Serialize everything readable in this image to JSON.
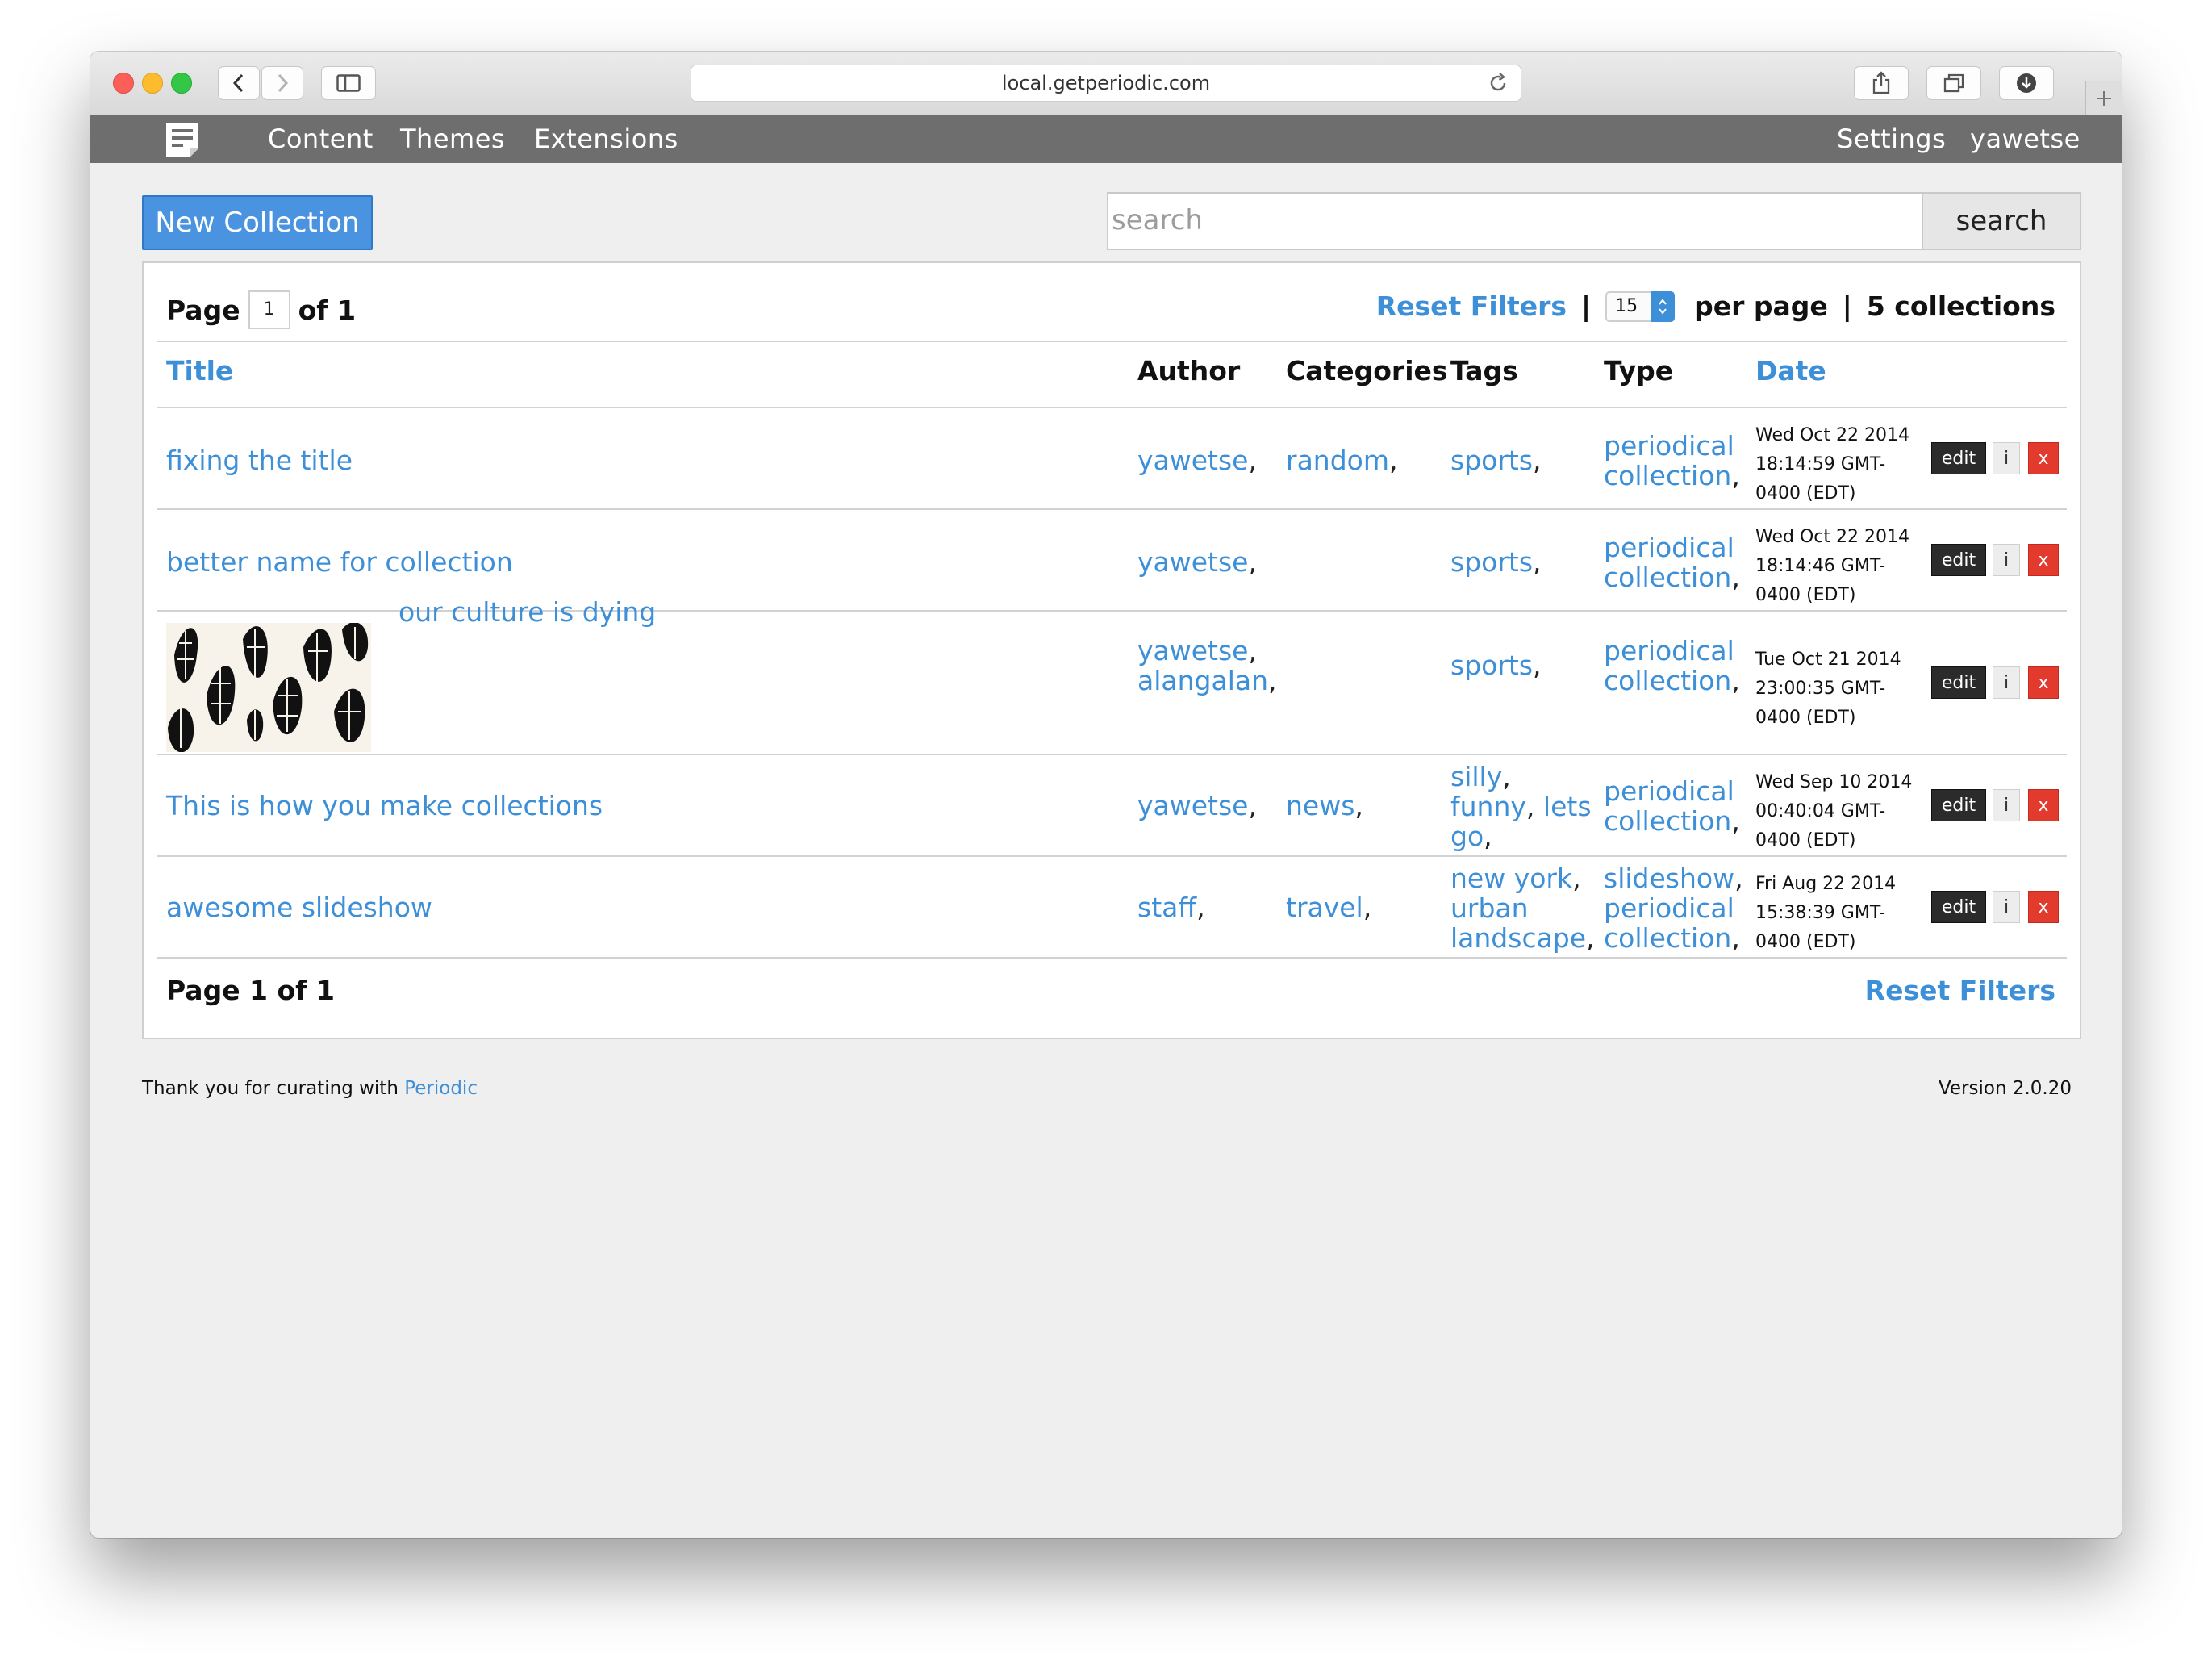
{
  "browser": {
    "url": "local.getperiodic.com"
  },
  "nav": {
    "left": [
      "Content",
      "Themes",
      "Extensions"
    ],
    "right": [
      "Settings",
      "yawetse"
    ]
  },
  "toolbar": {
    "new_collection_label": "New Collection",
    "search_placeholder": "search",
    "search_button_label": "search"
  },
  "pager_top": {
    "page_label": "Page",
    "current_page": "1",
    "of_label": "of 1",
    "reset_filters": "Reset Filters",
    "separator": "|",
    "per_page_value": "15",
    "per_page_label": "per page",
    "count_label": "5 collections"
  },
  "table": {
    "headers": {
      "title": "Title",
      "author": "Author",
      "categories": "Categories",
      "tags": "Tags",
      "type": "Type",
      "date": "Date"
    },
    "actions": {
      "edit": "edit",
      "info": "i",
      "delete": "x"
    },
    "rows": [
      {
        "title": "fixing the title",
        "authors": [
          "yawetse"
        ],
        "categories": [
          "random"
        ],
        "tags": [
          "sports"
        ],
        "types": [
          "periodical collection"
        ],
        "date": [
          "Wed Oct 22 2014",
          "18:14:59 GMT-",
          "0400 (EDT)"
        ]
      },
      {
        "title": "better name for collection",
        "authors": [
          "yawetse"
        ],
        "categories": [],
        "tags": [
          "sports"
        ],
        "types": [
          "periodical collection"
        ],
        "date": [
          "Wed Oct 22 2014",
          "18:14:46 GMT-",
          "0400 (EDT)"
        ]
      },
      {
        "title": "our culture is dying",
        "authors": [
          "yawetse",
          "alangalan"
        ],
        "categories": [],
        "tags": [
          "sports"
        ],
        "types": [
          "periodical collection"
        ],
        "date": [
          "Tue Oct 21 2014",
          "23:00:35 GMT-",
          "0400 (EDT)"
        ],
        "thumbnail": "feather-pattern-image"
      },
      {
        "title": "This is how you make collections",
        "authors": [
          "yawetse"
        ],
        "categories": [
          "news"
        ],
        "tags": [
          "silly",
          "funny",
          "lets go"
        ],
        "types": [
          "periodical collection"
        ],
        "date": [
          "Wed Sep 10 2014",
          "00:40:04 GMT-",
          "0400 (EDT)"
        ]
      },
      {
        "title": "awesome slideshow",
        "authors": [
          "staff"
        ],
        "categories": [
          "travel"
        ],
        "tags": [
          "new york",
          "urban landscape"
        ],
        "types": [
          "slideshow",
          "periodical collection"
        ],
        "date": [
          "Fri Aug 22 2014",
          "15:38:39 GMT-",
          "0400 (EDT)"
        ]
      }
    ]
  },
  "pager_bottom": {
    "label": "Page 1 of 1",
    "reset_filters": "Reset Filters"
  },
  "footer": {
    "thanks": "Thank you for curating with",
    "brand_link": "Periodic",
    "version": "Version 2.0.20"
  },
  "colors": {
    "link": "#3d8fd8",
    "nav_bar": "#6e6e6e",
    "primary_button": "#4a93e0",
    "delete_button": "#e23b2e",
    "edit_button": "#2b2b2b"
  }
}
